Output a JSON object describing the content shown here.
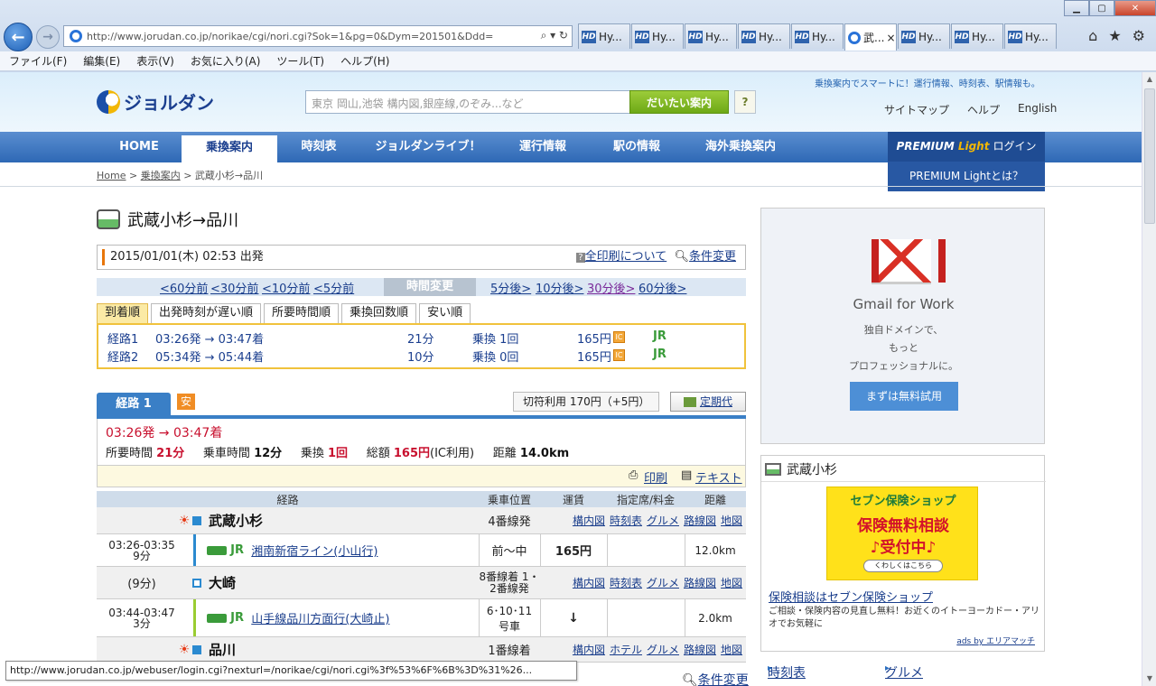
{
  "browser": {
    "url": "http://www.jorudan.co.jp/norikae/cgi/nori.cgi?Sok=1&pg=0&Dym=201501&Ddd=",
    "tabs": [
      {
        "label": "Hy..."
      },
      {
        "label": "Hy..."
      },
      {
        "label": "Hy..."
      },
      {
        "label": "Hy..."
      },
      {
        "label": "Hy..."
      },
      {
        "label": "武..."
      },
      {
        "label": "Hy..."
      },
      {
        "label": "Hy..."
      },
      {
        "label": "Hy..."
      }
    ],
    "menu": [
      "ファイル(F)",
      "編集(E)",
      "表示(V)",
      "お気に入り(A)",
      "ツール(T)",
      "ヘルプ(H)"
    ],
    "status_url": "http://www.jorudan.co.jp/webuser/login.cgi?nexturl=/norikae/cgi/nori.cgi%3f%53%6F%6B%3D%31%26..."
  },
  "header": {
    "logo": "ジョルダン",
    "search_placeholder": "東京 岡山,池袋 構内図,銀座線,のぞみ...など",
    "search_button": "だいたい案内",
    "help_button": "?",
    "promo": "乗換案内でスマートに！運行情報、時刻表、駅情報も。",
    "links": [
      "サイトマップ",
      "ヘルプ",
      "English"
    ]
  },
  "nav": {
    "items": [
      "HOME",
      "乗換案内",
      "時刻表",
      "ジョルダンライブ！",
      "運行情報",
      "駅の情報",
      "海外乗換案内"
    ],
    "premium_logo": "PREMIUM",
    "premium_light": "Light",
    "login": "ログイン",
    "premium_about": "PREMIUM Lightとは？"
  },
  "breadcrumb": {
    "home": "Home",
    "norikae": "乗換案内",
    "current": "武蔵小杉→品川"
  },
  "main": {
    "title": "武蔵小杉→品川",
    "datetime": "2015/01/01(木) 02:53 出発",
    "print_all": "全印刷について",
    "change_cond": "条件変更",
    "time_prev": [
      "<60分前",
      "<30分前",
      "<10分前",
      "<5分前"
    ],
    "time_mid": "時間変更",
    "time_next": [
      "5分後>",
      "10分後>",
      "30分後>",
      "60分後>"
    ],
    "sort_tabs": [
      "到着順",
      "出発時刻が遅い順",
      "所要時間順",
      "乗換回数順",
      "安い順"
    ],
    "routes": [
      {
        "name": "経路1",
        "time": "03:26発 → 03:47着",
        "dur": "21分",
        "transfer": "乗換 1回",
        "fare": "165円",
        "ic": "IC",
        "line": "JR"
      },
      {
        "name": "経路2",
        "time": "05:34発 → 05:44着",
        "dur": "10分",
        "transfer": "乗換 0回",
        "fare": "165円",
        "ic": "IC",
        "line": "JR"
      }
    ],
    "route_tab": "経路 1",
    "yasu": "安",
    "ticket_fare": "切符利用  170円（+5円）",
    "teiki": "定期代",
    "summary_time": "03:26発 → 03:47着",
    "summary": {
      "l1": "所要時間",
      "v1": "21分",
      "l2": "乗車時間",
      "v2": "12分",
      "l3": "乗換",
      "v3": "1回",
      "l4": "総額",
      "v4": "165円",
      "v4b": "(IC利用)",
      "l5": "距離",
      "v5": "14.0km"
    },
    "print": "印刷",
    "text": "テキスト",
    "table_head": [
      "経路",
      "乗車位置",
      "運賃",
      "指定席/料金",
      "距離"
    ],
    "stations": [
      {
        "name": "武蔵小杉",
        "platform": "4番線発",
        "links": [
          "構内図",
          "時刻表",
          "グルメ",
          "路線図",
          "地図"
        ]
      },
      {
        "name": "大崎",
        "platform": "8番線着 1・2番線発",
        "wait": "(9分)",
        "links": [
          "構内図",
          "時刻表",
          "グルメ",
          "路線図",
          "地図"
        ]
      },
      {
        "name": "品川",
        "platform": "1番線着",
        "links": [
          "構内図",
          "ホテル",
          "グルメ",
          "路線図",
          "地図"
        ]
      }
    ],
    "legs": [
      {
        "time": "03:26-03:35",
        "dur": "9分",
        "line_tag": "JR",
        "line": "湘南新宿ライン(小山行)",
        "pos": "前〜中",
        "fare": "165円",
        "dist": "12.0km"
      },
      {
        "time": "03:44-03:47",
        "dur": "3分",
        "line_tag": "JR",
        "line": "山手線品川方面行(大崎止)",
        "pos": "6･10･11号車",
        "fare": "↓",
        "dist": "2.0km"
      }
    ],
    "cond_bottom": "条件変更"
  },
  "sidebar": {
    "ad_title": "Gmail for Work",
    "ad_sub": [
      "独自ドメインで、",
      "もっと",
      "プロフェッショナルに。"
    ],
    "ad_button": "まずは無料試用",
    "station": "武蔵小杉",
    "banner_top": "セブン保険ショップ",
    "banner_l1": "保険無料相談",
    "banner_l2": "♪受付中♪",
    "banner_btn": "くわしくはこちら",
    "ins_link": "保険相談はセブン保険ショップ",
    "ins_desc": "ご相談・保険内容の見直し無料！お近くのイトーヨーカドー・アリオでお気軽に",
    "ads_by": "ads by エリアマッチ",
    "links": [
      "時刻表",
      "グルメ"
    ]
  }
}
